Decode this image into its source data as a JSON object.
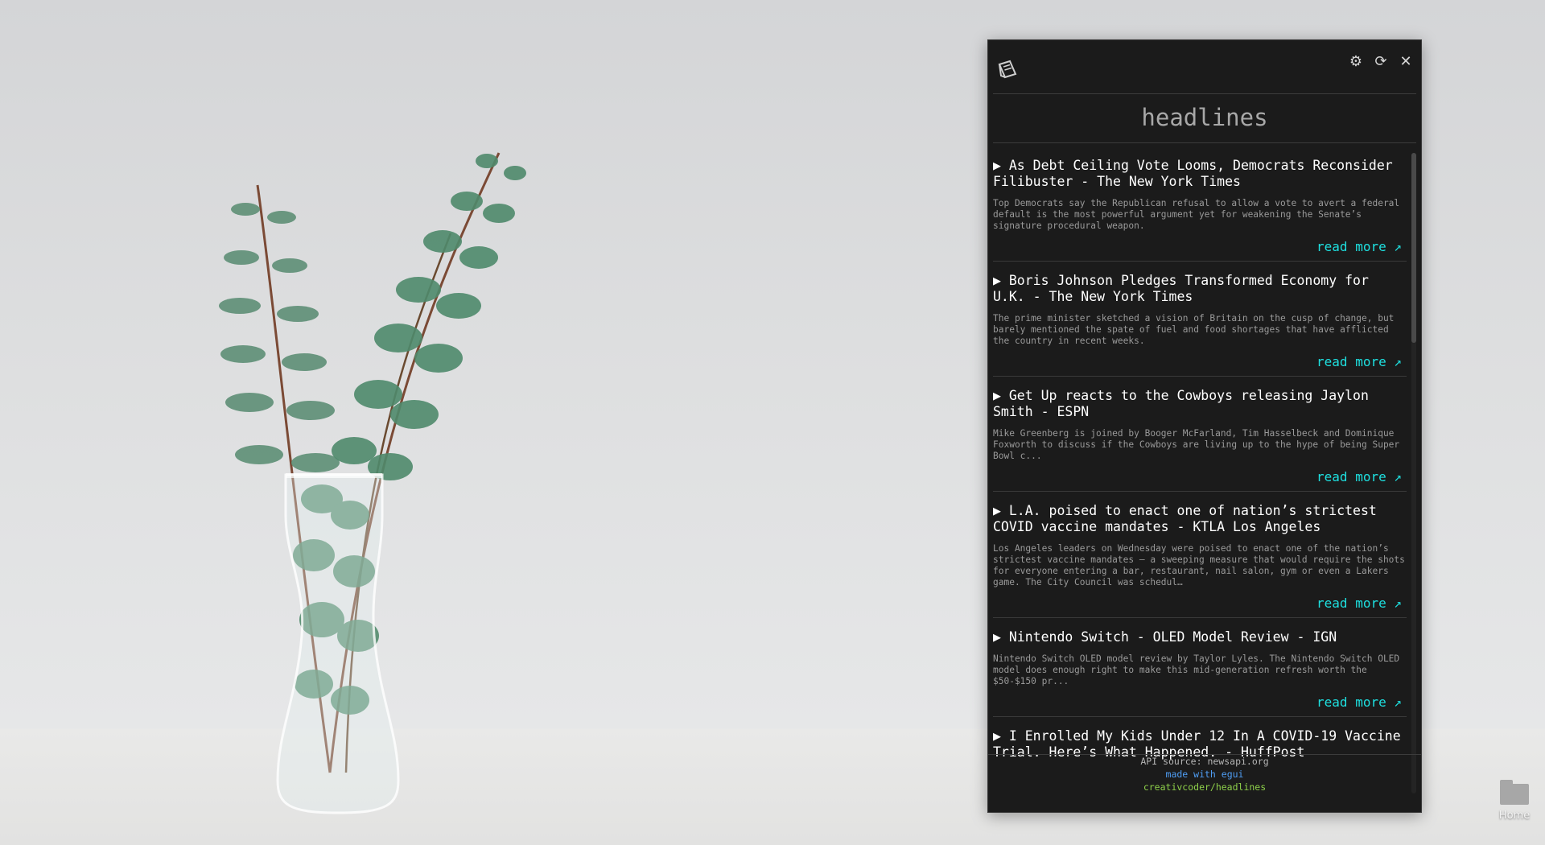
{
  "app": {
    "heading": "headlines",
    "controls": {
      "settings_icon": "gear-icon",
      "refresh_icon": "refresh-icon",
      "close_icon": "close-icon"
    }
  },
  "articles": [
    {
      "title": "▶ As Debt Ceiling Vote Looms, Democrats Reconsider Filibuster - The New York Times",
      "description": "Top Democrats say the Republican refusal to allow a vote to avert a federal default is the most powerful argument yet for weakening the Senate’s signature procedural weapon.",
      "read_more": "read more ↗"
    },
    {
      "title": "▶ Boris Johnson Pledges Transformed Economy for U.K. - The New York Times",
      "description": "The prime minister sketched a vision of Britain on the cusp of change, but barely mentioned the spate of fuel and food shortages that have afflicted the country in recent weeks.",
      "read_more": "read more ↗"
    },
    {
      "title": "▶ Get Up reacts to the Cowboys releasing Jaylon Smith - ESPN",
      "description": "Mike Greenberg is joined by Booger McFarland, Tim Hasselbeck and Dominique Foxworth to discuss if the Cowboys are living up to the hype of being Super Bowl c...",
      "read_more": "read more ↗"
    },
    {
      "title": "▶ L.A. poised to enact one of nation’s strictest COVID vaccine mandates - KTLA Los Angeles",
      "description": "Los Angeles leaders on Wednesday were poised to enact one of the nation’s strictest vaccine mandates — a sweeping measure that would require the shots for everyone entering a bar, restaurant, nail salon, gym or even a Lakers game. The City Council was schedul…",
      "read_more": "read more ↗"
    },
    {
      "title": "▶ Nintendo Switch - OLED Model Review - IGN",
      "description": "Nintendo Switch OLED model review by Taylor Lyles. The Nintendo Switch OLED model does enough right to make this mid-generation refresh worth the $50-$150 pr...",
      "read_more": "read more ↗"
    },
    {
      "title": "▶ I Enrolled My Kids Under 12 In A COVID-19 Vaccine Trial. Here’s What Happened. - HuffPost",
      "description": "",
      "read_more": ""
    }
  ],
  "footer": {
    "api_source": "API source: newsapi.org",
    "made_with": "made with egui",
    "repo": "creativcoder/headlines"
  },
  "desktop": {
    "home_label": "Home",
    "home_icon": "folder-icon"
  },
  "colors": {
    "accent": "#1ee0e0",
    "link_blue": "#4f9ef5",
    "repo_green": "#8ed04a",
    "window_bg": "#1b1b1b"
  }
}
